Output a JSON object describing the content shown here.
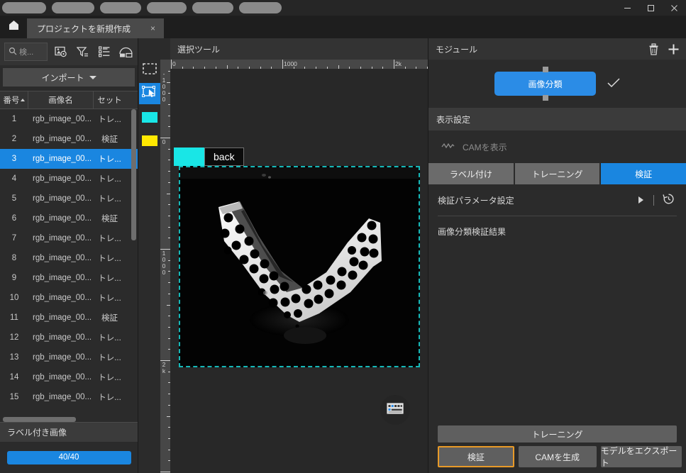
{
  "window": {
    "pills": [
      "",
      "",
      "",
      "",
      "",
      ""
    ],
    "minimize_label": "—",
    "maximize_label": "☐",
    "close_label": "✕"
  },
  "tabs": {
    "home_icon": "home-icon",
    "project_tab_label": "プロジェクトを新規作成",
    "project_tab_close": "×"
  },
  "left_panel": {
    "search_placeholder": "検...",
    "icons": [
      "image-settings-icon",
      "filter-icon",
      "list-view-icon",
      "gallery-view-icon"
    ],
    "import_label": "インポート",
    "table": {
      "headers": [
        "番号",
        "画像名",
        "セット"
      ],
      "rows": [
        {
          "no": "1",
          "name": "rgb_image_00...",
          "set": "トレ..."
        },
        {
          "no": "2",
          "name": "rgb_image_00...",
          "set": "検証"
        },
        {
          "no": "3",
          "name": "rgb_image_00...",
          "set": "トレ..."
        },
        {
          "no": "4",
          "name": "rgb_image_00...",
          "set": "トレ..."
        },
        {
          "no": "5",
          "name": "rgb_image_00...",
          "set": "トレ..."
        },
        {
          "no": "6",
          "name": "rgb_image_00...",
          "set": "検証"
        },
        {
          "no": "7",
          "name": "rgb_image_00...",
          "set": "トレ..."
        },
        {
          "no": "8",
          "name": "rgb_image_00...",
          "set": "トレ..."
        },
        {
          "no": "9",
          "name": "rgb_image_00...",
          "set": "トレ..."
        },
        {
          "no": "10",
          "name": "rgb_image_00...",
          "set": "トレ..."
        },
        {
          "no": "11",
          "name": "rgb_image_00...",
          "set": "検証"
        },
        {
          "no": "12",
          "name": "rgb_image_00...",
          "set": "トレ..."
        },
        {
          "no": "13",
          "name": "rgb_image_00...",
          "set": "トレ..."
        },
        {
          "no": "14",
          "name": "rgb_image_00...",
          "set": "トレ..."
        },
        {
          "no": "15",
          "name": "rgb_image_00...",
          "set": "トレ..."
        }
      ],
      "selected_row_index": 2
    },
    "labeled_images_label": "ラベル付き画像",
    "progress_label": "40/40",
    "progress_percent": 100,
    "accent_color": "#1a86e0"
  },
  "tools": {
    "items": [
      {
        "name": "marquee-select-tool",
        "active": false
      },
      {
        "name": "move-select-tool",
        "active": true
      },
      {
        "name": "swatch-cyan-tool",
        "active": false,
        "color": "#19e6e6"
      },
      {
        "name": "swatch-yellow-tool",
        "active": false,
        "color": "#ffe800"
      }
    ]
  },
  "canvas": {
    "title": "選択ツール",
    "ruler_h_labels": [
      "0",
      "1000",
      "2k"
    ],
    "ruler_v_labels": [
      "-1000",
      "0",
      "1000",
      "2k"
    ],
    "label_chip_text": "back",
    "label_chip_color": "#19e6e6",
    "selection_border_color": "#15b8b8",
    "keyboard_shortcut_icon": "keyboard-icon"
  },
  "right_panel": {
    "title": "モジュール",
    "delete_icon": "trash-icon",
    "add_icon": "plus-icon",
    "module_node_label": "画像分類",
    "module_node_color": "#2b8ce6",
    "module_check_icon": "check-icon",
    "display_settings_label": "表示設定",
    "cam_toggle_label": "CAMを表示",
    "cam_toggle_icon": "cam-curve-icon",
    "tabs": [
      {
        "label": "ラベル付け",
        "active": false
      },
      {
        "label": "トレーニング",
        "active": false
      },
      {
        "label": "検証",
        "active": true
      }
    ],
    "param_label": "検証パラメータ設定",
    "param_expand_icon": "triangle-right-icon",
    "param_reset_icon": "history-reset-icon",
    "result_label": "画像分類検証結果",
    "footer": {
      "train_label": "トレーニング",
      "verify_label": "検証",
      "cam_label": "CAMを生成",
      "export_label": "モデルをエクスポート",
      "verify_highlight_color": "#e89a28"
    }
  }
}
